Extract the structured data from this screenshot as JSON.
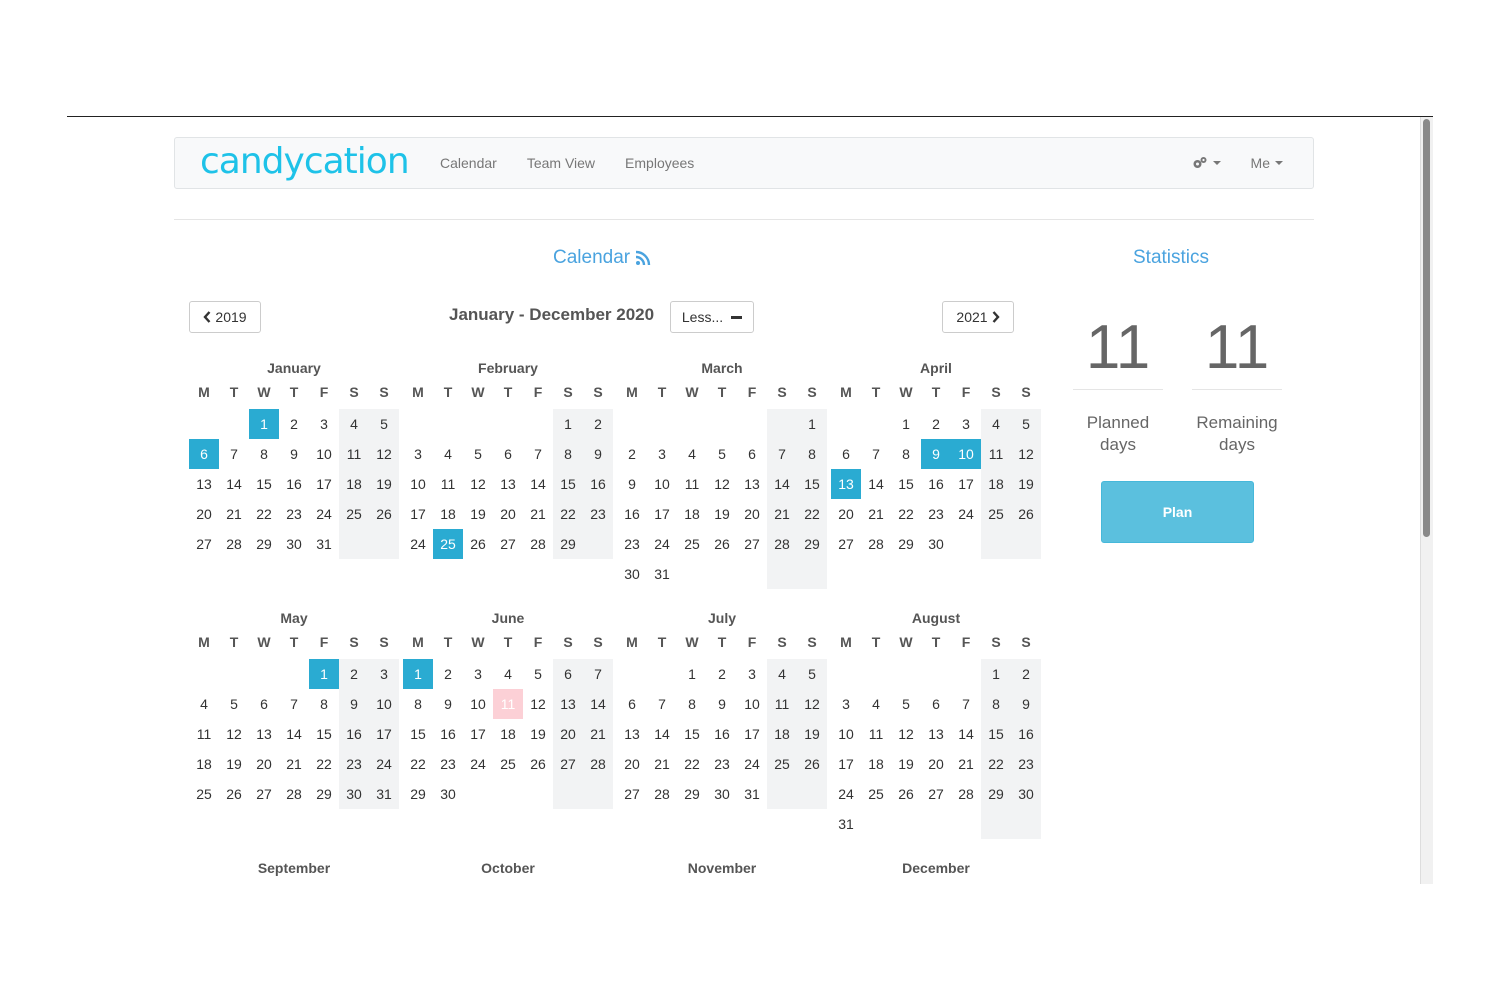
{
  "nav": {
    "brand": "candycation",
    "links": [
      "Calendar",
      "Team View",
      "Employees"
    ],
    "me_label": "Me"
  },
  "calendar": {
    "title": "Calendar",
    "prev_year": "2019",
    "next_year": "2021",
    "range_title": "January - December 2020",
    "toggle_label": "Less...",
    "dow": [
      "M",
      "T",
      "W",
      "T",
      "F",
      "S",
      "S"
    ],
    "months": [
      {
        "name": "January",
        "offset": 2,
        "days": 31,
        "selected": [
          1,
          6
        ]
      },
      {
        "name": "February",
        "offset": 5,
        "days": 29,
        "selected": [
          25
        ]
      },
      {
        "name": "March",
        "offset": 6,
        "days": 31,
        "selected": []
      },
      {
        "name": "April",
        "offset": 2,
        "days": 30,
        "selected": [
          9,
          10,
          13
        ]
      },
      {
        "name": "May",
        "offset": 4,
        "days": 31,
        "selected": [
          1
        ]
      },
      {
        "name": "June",
        "offset": 0,
        "days": 30,
        "selected": [
          1
        ],
        "today": 11
      },
      {
        "name": "July",
        "offset": 2,
        "days": 31,
        "selected": []
      },
      {
        "name": "August",
        "offset": 5,
        "days": 31,
        "selected": []
      }
    ],
    "more_months": [
      "September",
      "October",
      "November",
      "December"
    ],
    "colors": {
      "selected": "#2aabd2",
      "today": "#fcd0d6",
      "weekend": "#f2f3f4"
    }
  },
  "statistics": {
    "title": "Statistics",
    "planned_value": "11",
    "planned_label": [
      "Planned",
      "days"
    ],
    "remaining_value": "11",
    "remaining_label": [
      "Remaining",
      "days"
    ],
    "plan_button": "Plan"
  }
}
